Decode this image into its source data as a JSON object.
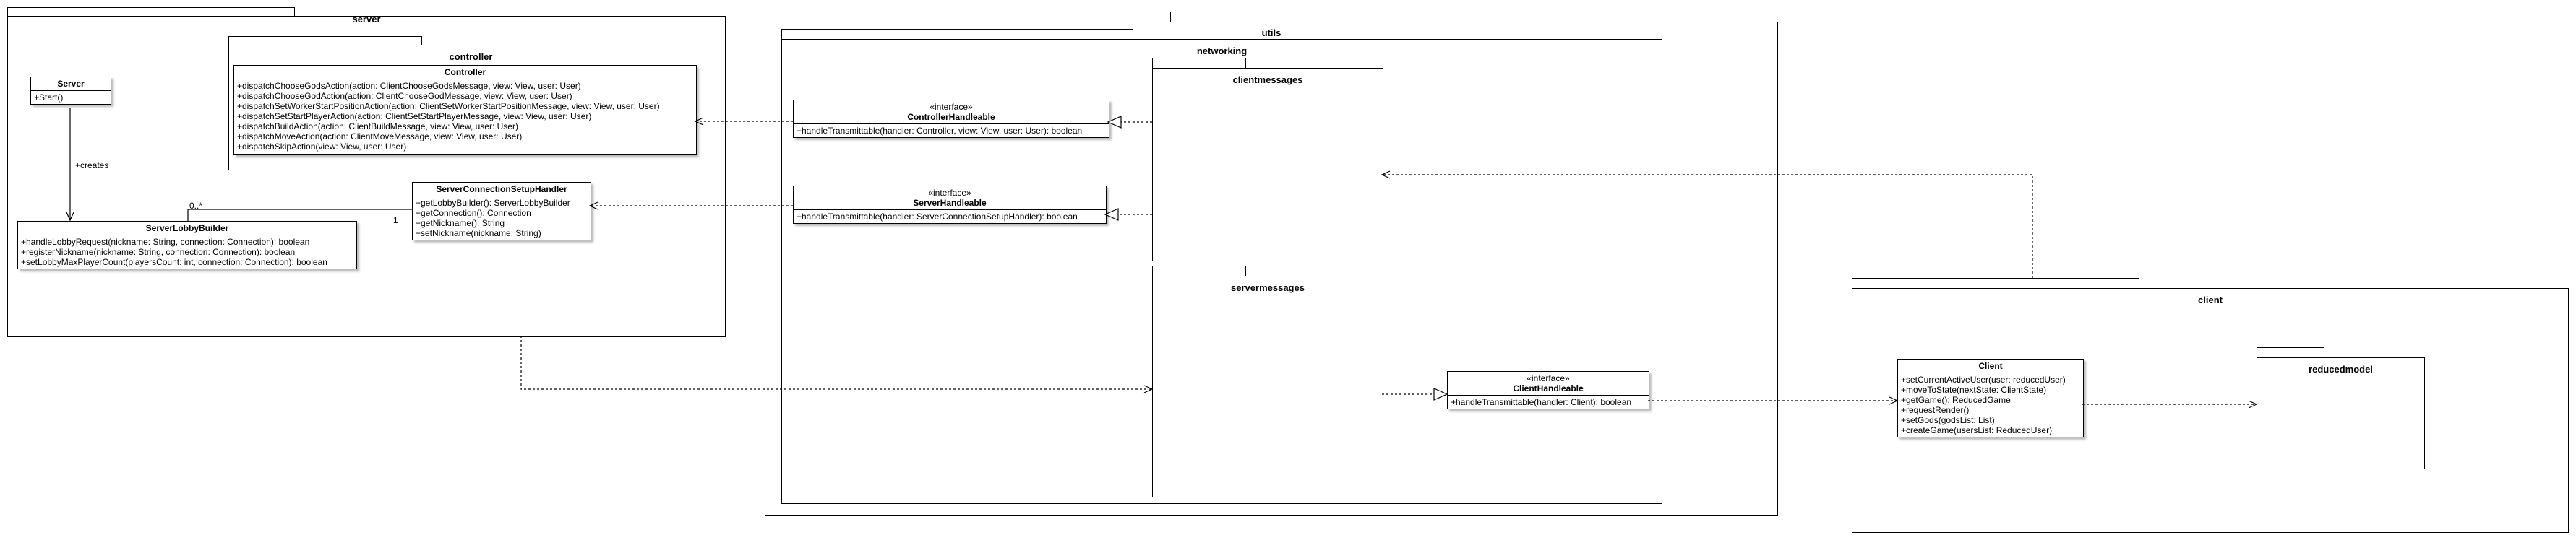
{
  "packages": {
    "server": "server",
    "controller": "controller",
    "utils": "utils",
    "networking": "networking",
    "clientmessages": "clientmessages",
    "servermessages": "servermessages",
    "client": "client",
    "reducedmodel": "reducedmodel"
  },
  "classes": {
    "server": {
      "name": "Server",
      "members": [
        "+Start()"
      ]
    },
    "controller": {
      "name": "Controller",
      "members": [
        "+dispatchChooseGodsAction(action: ClientChooseGodsMessage, view: View, user: User)",
        "+dispatchChooseGodAction(action: ClientChooseGodMessage, view: View, user: User)",
        "+dispatchSetWorkerStartPositionAction(action: ClientSetWorkerStartPositionMessage, view: View, user: User)",
        "+dispatchSetStartPlayerAction(action: ClientSetStartPlayerMessage, view: View, user: User)",
        "+dispatchBuildAction(action: ClientBuildMessage, view: View, user: User)",
        "+dispatchMoveAction(action: ClientMoveMessage, view: View, user: User)",
        "+dispatchSkipAction(view: View, user: User)"
      ]
    },
    "lobby": {
      "name": "ServerLobbyBuilder",
      "members": [
        "+handleLobbyRequest(nickname: String, connection: Connection): boolean",
        "+registerNickname(nickname: String, connection: Connection): boolean",
        "+setLobbyMaxPlayerCount(playersCount: int, connection: Connection): boolean"
      ]
    },
    "setup": {
      "name": "ServerConnectionSetupHandler",
      "members": [
        "+getLobbyBuilder(): ServerLobbyBuilder",
        "+getConnection(): Connection",
        "+getNickname(): String",
        "+setNickname(nickname: String)"
      ]
    },
    "controllerHandleable": {
      "stereotype": "«interface»",
      "name": "ControllerHandleable",
      "members": [
        "+handleTransmittable(handler: Controller, view: View, user: User): boolean"
      ]
    },
    "serverHandleable": {
      "stereotype": "«interface»",
      "name": "ServerHandleable",
      "members": [
        "+handleTransmittable(handler: ServerConnectionSetupHandler): boolean"
      ]
    },
    "clientHandleable": {
      "stereotype": "«interface»",
      "name": "ClientHandleable",
      "members": [
        "+handleTransmittable(handler: Client): boolean"
      ]
    },
    "client": {
      "name": "Client",
      "members": [
        "+setCurrentActiveUser(user: reducedUser)",
        "+moveToState(nextState: ClientState)",
        "+getGame(): ReducedGame",
        "+requestRender()",
        "+setGods(godsList: List)",
        "+createGame(usersList: ReducedUser)"
      ]
    }
  },
  "labels": {
    "creates": "+creates",
    "multiplicity_many": "0..*",
    "multiplicity_one": "1"
  }
}
